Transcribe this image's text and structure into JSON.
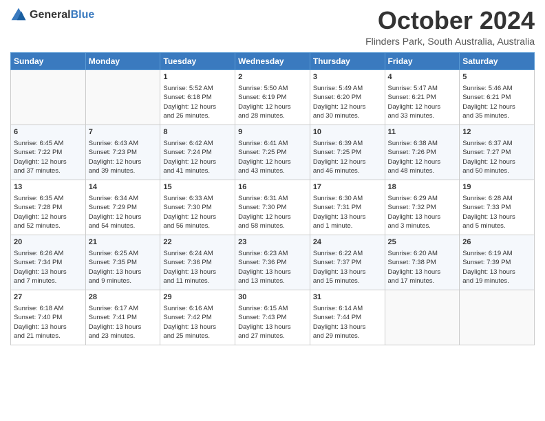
{
  "logo": {
    "text_general": "General",
    "text_blue": "Blue"
  },
  "header": {
    "month": "October 2024",
    "location": "Flinders Park, South Australia, Australia"
  },
  "days_of_week": [
    "Sunday",
    "Monday",
    "Tuesday",
    "Wednesday",
    "Thursday",
    "Friday",
    "Saturday"
  ],
  "weeks": [
    [
      {
        "day": "",
        "content": ""
      },
      {
        "day": "",
        "content": ""
      },
      {
        "day": "1",
        "content": "Sunrise: 5:52 AM\nSunset: 6:18 PM\nDaylight: 12 hours\nand 26 minutes."
      },
      {
        "day": "2",
        "content": "Sunrise: 5:50 AM\nSunset: 6:19 PM\nDaylight: 12 hours\nand 28 minutes."
      },
      {
        "day": "3",
        "content": "Sunrise: 5:49 AM\nSunset: 6:20 PM\nDaylight: 12 hours\nand 30 minutes."
      },
      {
        "day": "4",
        "content": "Sunrise: 5:47 AM\nSunset: 6:21 PM\nDaylight: 12 hours\nand 33 minutes."
      },
      {
        "day": "5",
        "content": "Sunrise: 5:46 AM\nSunset: 6:21 PM\nDaylight: 12 hours\nand 35 minutes."
      }
    ],
    [
      {
        "day": "6",
        "content": "Sunrise: 6:45 AM\nSunset: 7:22 PM\nDaylight: 12 hours\nand 37 minutes."
      },
      {
        "day": "7",
        "content": "Sunrise: 6:43 AM\nSunset: 7:23 PM\nDaylight: 12 hours\nand 39 minutes."
      },
      {
        "day": "8",
        "content": "Sunrise: 6:42 AM\nSunset: 7:24 PM\nDaylight: 12 hours\nand 41 minutes."
      },
      {
        "day": "9",
        "content": "Sunrise: 6:41 AM\nSunset: 7:25 PM\nDaylight: 12 hours\nand 43 minutes."
      },
      {
        "day": "10",
        "content": "Sunrise: 6:39 AM\nSunset: 7:25 PM\nDaylight: 12 hours\nand 46 minutes."
      },
      {
        "day": "11",
        "content": "Sunrise: 6:38 AM\nSunset: 7:26 PM\nDaylight: 12 hours\nand 48 minutes."
      },
      {
        "day": "12",
        "content": "Sunrise: 6:37 AM\nSunset: 7:27 PM\nDaylight: 12 hours\nand 50 minutes."
      }
    ],
    [
      {
        "day": "13",
        "content": "Sunrise: 6:35 AM\nSunset: 7:28 PM\nDaylight: 12 hours\nand 52 minutes."
      },
      {
        "day": "14",
        "content": "Sunrise: 6:34 AM\nSunset: 7:29 PM\nDaylight: 12 hours\nand 54 minutes."
      },
      {
        "day": "15",
        "content": "Sunrise: 6:33 AM\nSunset: 7:30 PM\nDaylight: 12 hours\nand 56 minutes."
      },
      {
        "day": "16",
        "content": "Sunrise: 6:31 AM\nSunset: 7:30 PM\nDaylight: 12 hours\nand 58 minutes."
      },
      {
        "day": "17",
        "content": "Sunrise: 6:30 AM\nSunset: 7:31 PM\nDaylight: 13 hours\nand 1 minute."
      },
      {
        "day": "18",
        "content": "Sunrise: 6:29 AM\nSunset: 7:32 PM\nDaylight: 13 hours\nand 3 minutes."
      },
      {
        "day": "19",
        "content": "Sunrise: 6:28 AM\nSunset: 7:33 PM\nDaylight: 13 hours\nand 5 minutes."
      }
    ],
    [
      {
        "day": "20",
        "content": "Sunrise: 6:26 AM\nSunset: 7:34 PM\nDaylight: 13 hours\nand 7 minutes."
      },
      {
        "day": "21",
        "content": "Sunrise: 6:25 AM\nSunset: 7:35 PM\nDaylight: 13 hours\nand 9 minutes."
      },
      {
        "day": "22",
        "content": "Sunrise: 6:24 AM\nSunset: 7:36 PM\nDaylight: 13 hours\nand 11 minutes."
      },
      {
        "day": "23",
        "content": "Sunrise: 6:23 AM\nSunset: 7:36 PM\nDaylight: 13 hours\nand 13 minutes."
      },
      {
        "day": "24",
        "content": "Sunrise: 6:22 AM\nSunset: 7:37 PM\nDaylight: 13 hours\nand 15 minutes."
      },
      {
        "day": "25",
        "content": "Sunrise: 6:20 AM\nSunset: 7:38 PM\nDaylight: 13 hours\nand 17 minutes."
      },
      {
        "day": "26",
        "content": "Sunrise: 6:19 AM\nSunset: 7:39 PM\nDaylight: 13 hours\nand 19 minutes."
      }
    ],
    [
      {
        "day": "27",
        "content": "Sunrise: 6:18 AM\nSunset: 7:40 PM\nDaylight: 13 hours\nand 21 minutes."
      },
      {
        "day": "28",
        "content": "Sunrise: 6:17 AM\nSunset: 7:41 PM\nDaylight: 13 hours\nand 23 minutes."
      },
      {
        "day": "29",
        "content": "Sunrise: 6:16 AM\nSunset: 7:42 PM\nDaylight: 13 hours\nand 25 minutes."
      },
      {
        "day": "30",
        "content": "Sunrise: 6:15 AM\nSunset: 7:43 PM\nDaylight: 13 hours\nand 27 minutes."
      },
      {
        "day": "31",
        "content": "Sunrise: 6:14 AM\nSunset: 7:44 PM\nDaylight: 13 hours\nand 29 minutes."
      },
      {
        "day": "",
        "content": ""
      },
      {
        "day": "",
        "content": ""
      }
    ]
  ]
}
